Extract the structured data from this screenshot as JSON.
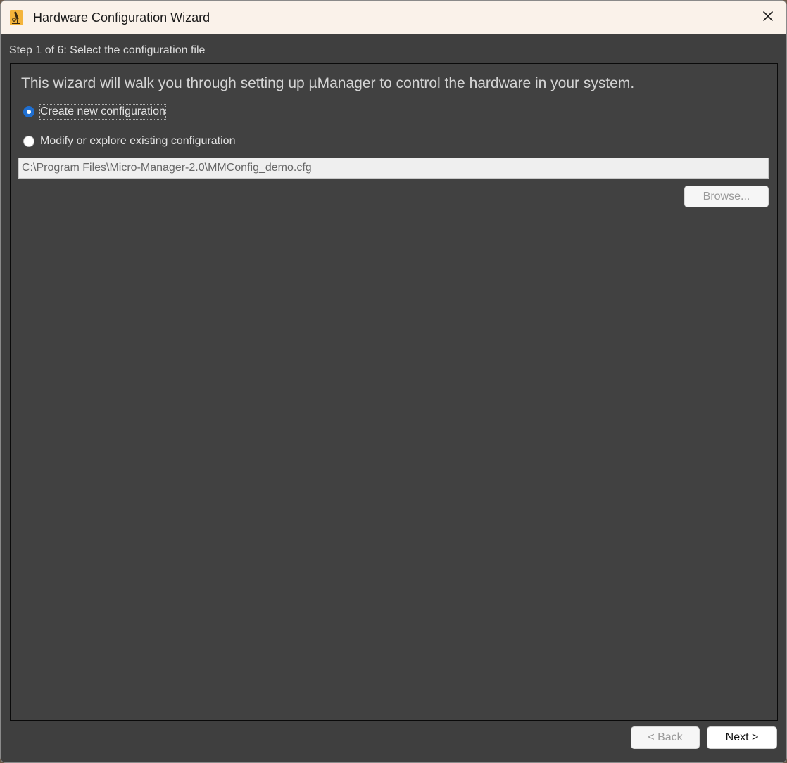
{
  "window": {
    "title": "Hardware Configuration Wizard",
    "app_icon": "microscope-icon",
    "close_icon": "close-icon"
  },
  "step": {
    "label": "Step 1 of 6: Select the configuration file"
  },
  "intro": {
    "text": "This wizard will walk you through setting up µManager to control the hardware in your system."
  },
  "options": {
    "create_new": {
      "label": "Create new configuration",
      "selected": true
    },
    "modify_existing": {
      "label": "Modify or explore existing configuration",
      "selected": false
    }
  },
  "config_file": {
    "value": "C:\\Program Files\\Micro-Manager-2.0\\MMConfig_demo.cfg",
    "enabled": false
  },
  "buttons": {
    "browse": {
      "label": "Browse...",
      "enabled": false
    },
    "back": {
      "label": "< Back",
      "enabled": false
    },
    "next": {
      "label": "Next >",
      "enabled": true
    }
  },
  "colors": {
    "titlebar_bg": "#faf2ea",
    "panel_bg": "#414141",
    "radio_accent": "#1f6fd1"
  }
}
